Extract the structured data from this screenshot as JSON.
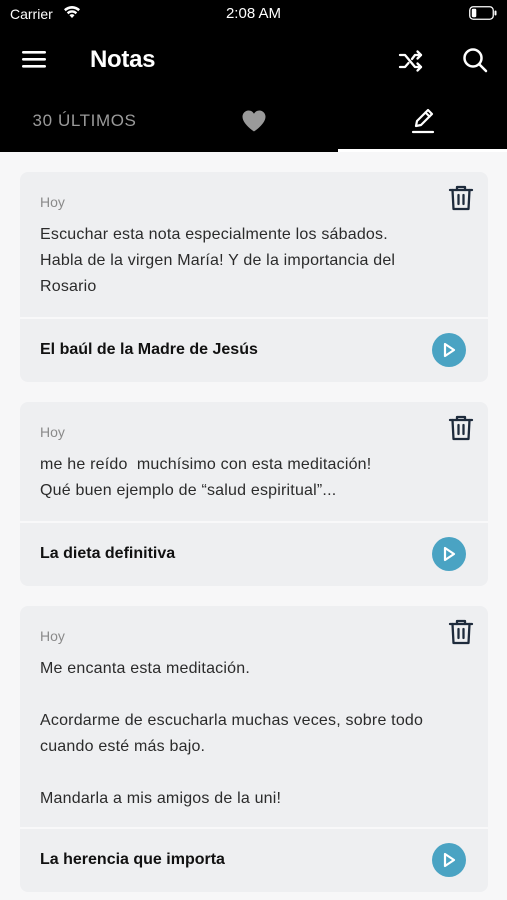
{
  "status_bar": {
    "carrier": "Carrier",
    "time": "2:08 AM"
  },
  "header": {
    "title": "Notas",
    "menu_icon": "hamburger-menu-icon",
    "shuffle_icon": "shuffle-icon",
    "search_icon": "search-icon"
  },
  "tabs": {
    "latest_label": "30 ÚLTIMOS",
    "favorites_icon": "heart-icon",
    "notes_icon": "pencil-icon",
    "active": "notes"
  },
  "colors": {
    "accent": "#4aa3c3",
    "card_bg": "#eeeff1",
    "header_bg": "#000000"
  },
  "notes": [
    {
      "date": "Hoy",
      "text": "Escuchar esta nota especialmente los sábados.\nHabla de la virgen María! Y de la importancia del Rosario",
      "meditation_title": "El baúl de la Madre de Jesús"
    },
    {
      "date": "Hoy",
      "text": "me he reído  muchísimo con esta meditación!\nQué buen ejemplo de “salud espiritual”...",
      "meditation_title": "La dieta definitiva"
    },
    {
      "date": "Hoy",
      "text": "Me encanta esta meditación.\n\nAcordarme de escucharla muchas veces, sobre todo cuando esté más bajo.\n\nMandarla a mis amigos de la uni!",
      "meditation_title": "La herencia que importa"
    }
  ]
}
